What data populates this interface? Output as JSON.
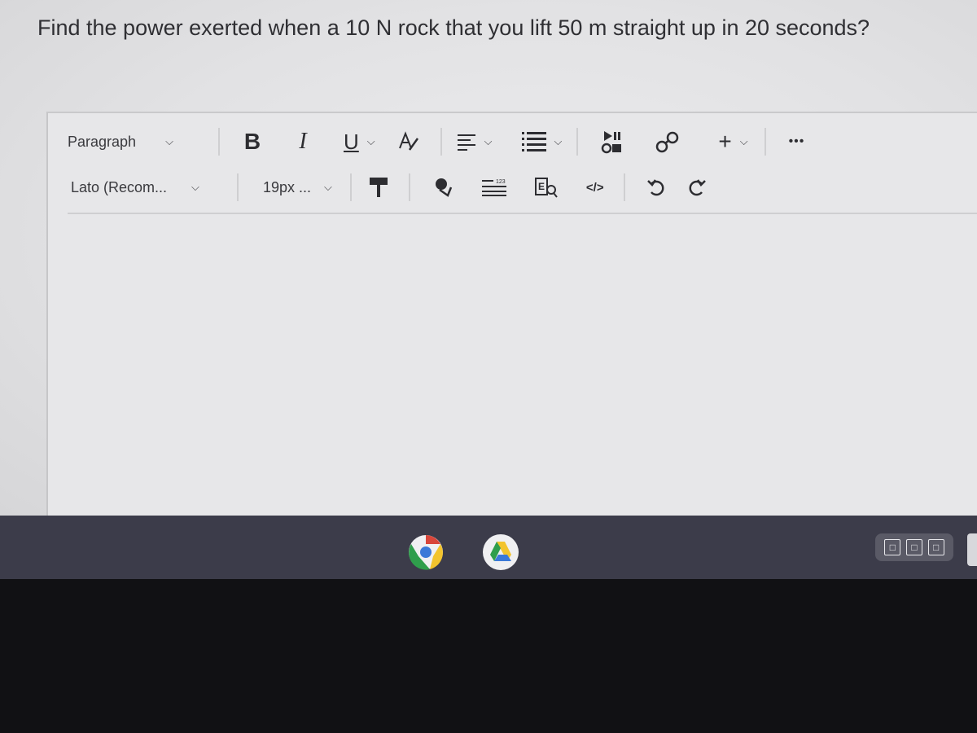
{
  "question": {
    "text": "Find the power exerted when a 10 N rock that you lift 50 m straight up in 20 seconds?"
  },
  "toolbar": {
    "block_format": "Paragraph",
    "font_family": "Lato (Recom...",
    "font_size": "19px ...",
    "bold_label": "B",
    "italic_label": "I",
    "underline_label": "U",
    "text_color_label": "A",
    "code_label": "</>",
    "more_label": "•••",
    "insert_label": "+"
  },
  "icons": {
    "block_dropdown": "chevron-down-icon",
    "bold": "bold-icon",
    "italic": "italic-icon",
    "underline": "underline-icon",
    "text_color": "text-color-icon",
    "align": "align-left-icon",
    "list": "bulleted-list-icon",
    "media": "media-icon",
    "link": "link-icon",
    "insert": "plus-icon",
    "more": "more-icon",
    "clear_format": "paint-format-icon",
    "highlight": "highlighter-icon",
    "numbered": "numbered-list-icon",
    "equation": "equation-icon",
    "code": "code-icon",
    "undo": "undo-icon",
    "redo": "redo-icon",
    "chrome": "chrome-icon",
    "drive": "google-drive-icon"
  },
  "colors": {
    "taskbar": "#3c3c4a",
    "text": "#2f2f33"
  }
}
